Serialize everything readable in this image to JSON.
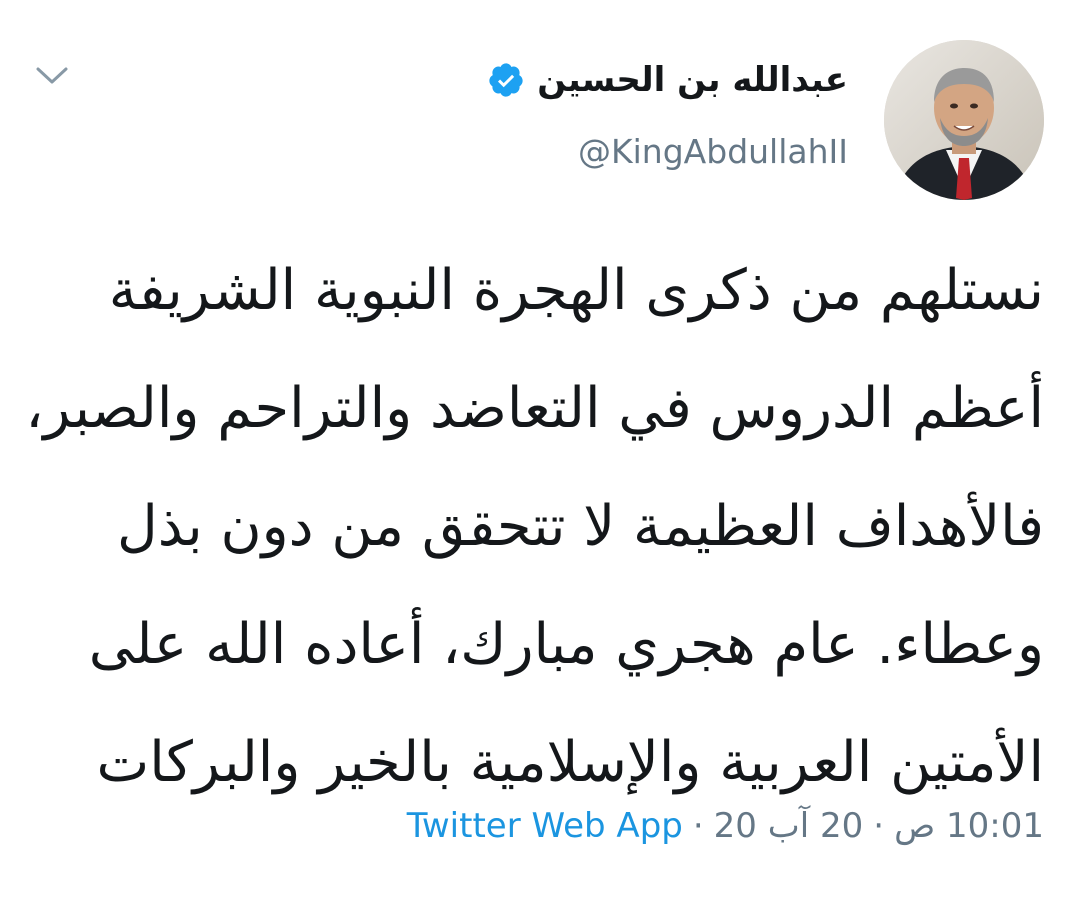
{
  "tweet": {
    "author": {
      "display_name": "عبدالله بن الحسين",
      "handle": "@KingAbdullahII",
      "verified": true,
      "verified_icon": "verified-badge-icon",
      "avatar_desc": "avatar"
    },
    "menu_icon": "chevron-down-icon",
    "text_lines": [
      "نستلهم من ذكرى الهجرة النبوية الشريفة",
      "أعظم الدروس في التعاضد والتراحم والصبر،",
      "فالأهداف العظيمة لا تتحقق من دون بذل",
      "وعطاء. عام هجري مبارك، أعاده الله على",
      "الأمتين العربية والإسلامية بالخير والبركات"
    ],
    "meta": {
      "time": "10:01 ص",
      "separator": "·",
      "date": "20 آب 20",
      "source": "Twitter Web App"
    }
  },
  "colors": {
    "text": "#14171a",
    "secondary": "#657786",
    "link": "#1b95e0",
    "verified": "#1da1f2"
  }
}
